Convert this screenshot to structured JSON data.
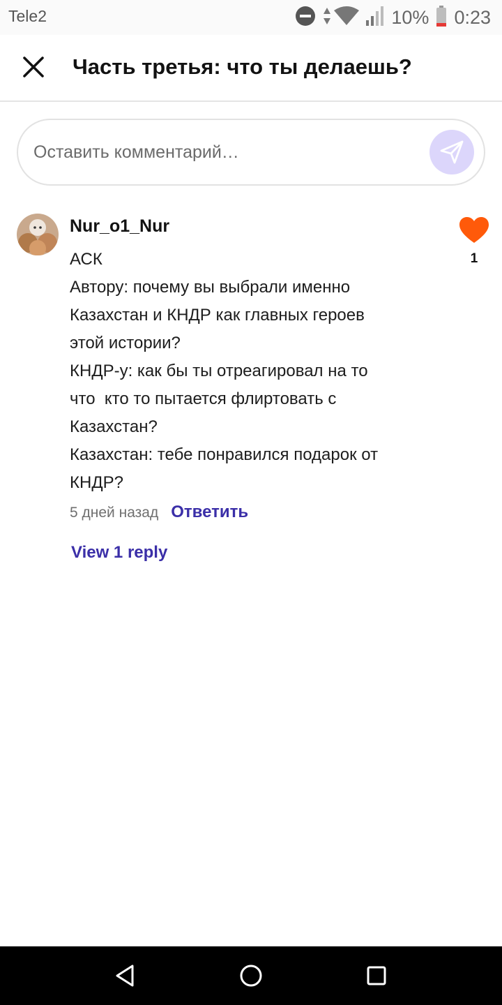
{
  "status_bar": {
    "carrier": "Tele2",
    "battery_percent": "10%",
    "time": "0:23",
    "icons": [
      "do-not-disturb-icon",
      "data-arrows-icon",
      "wifi-icon",
      "cell-signal-icon",
      "battery-low-icon"
    ]
  },
  "header": {
    "title": "Часть третья: что ты делаешь?",
    "close_icon": "close-icon"
  },
  "comment_input": {
    "placeholder": "Оставить комментарий…",
    "send_icon": "send-icon"
  },
  "comment": {
    "username": "Nur_o1_Nur",
    "avatar_icon": "avatar",
    "lines": [
      "АСК",
      "Автору: почему вы выбрали именно",
      "Казахстан и КНДР как главных героев",
      "этой истории?",
      "КНДР-у: как бы ты отреагировал на то",
      "что  кто то пытается флиртовать с",
      "Казахстан?",
      "Казахстан: тебе понравился подарок от",
      "КНДР?"
    ],
    "timestamp": "5 дней назад",
    "reply_label": "Ответить",
    "view_replies_label": "View 1 reply",
    "like_count": "1",
    "like_icon": "heart-icon"
  },
  "nav_bar": {
    "back_icon": "back-icon",
    "home_icon": "home-icon",
    "recents_icon": "recents-icon"
  },
  "colors": {
    "accent": "#3b2fa8",
    "like": "#ff5a0a",
    "send_button_bg": "#dcd6fb"
  }
}
